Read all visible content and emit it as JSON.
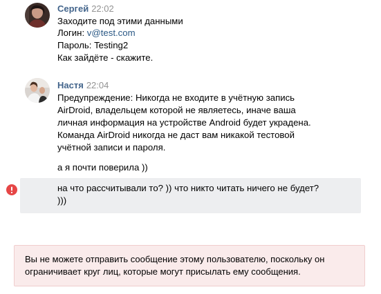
{
  "messages": [
    {
      "author": "Сергей",
      "time": "22:02",
      "lines": [
        "Заходите под этими данными",
        "Логин: ",
        "Пароль: Testing2",
        "Как зайдёте - скажите."
      ],
      "login_link": "v@test.com"
    },
    {
      "author": "Настя",
      "time": "22:04",
      "lines": [
        "Предупреждение: Никогда не входите в учётную запись",
        "AirDroid, владельцем которой не являетесь, иначе ваша",
        "личная информация на устройстве Android будет украдена.",
        "Команда AirDroid никогда не даст вам никакой тестовой",
        "учётной записи и пароля."
      ],
      "followups": [
        "а я почти поверила ))"
      ],
      "failed_message_lines": [
        "на что рассчитывали то? )) что никто читать ничего не будет?",
        ")))"
      ]
    }
  ],
  "error_icon": "exclamation-circle-icon",
  "notice": {
    "lines": [
      "Вы не можете отправить сообщение этому пользователю, поскольку он",
      "ограничивает круг лиц, которые могут присылать ему сообщения."
    ]
  },
  "colors": {
    "author": "#42648b",
    "time": "#939393",
    "link": "#2a5885",
    "highlight_bg": "#edeef0",
    "error": "#e64646",
    "notice_bg": "#faebeb",
    "notice_border": "#f0cdcd"
  }
}
